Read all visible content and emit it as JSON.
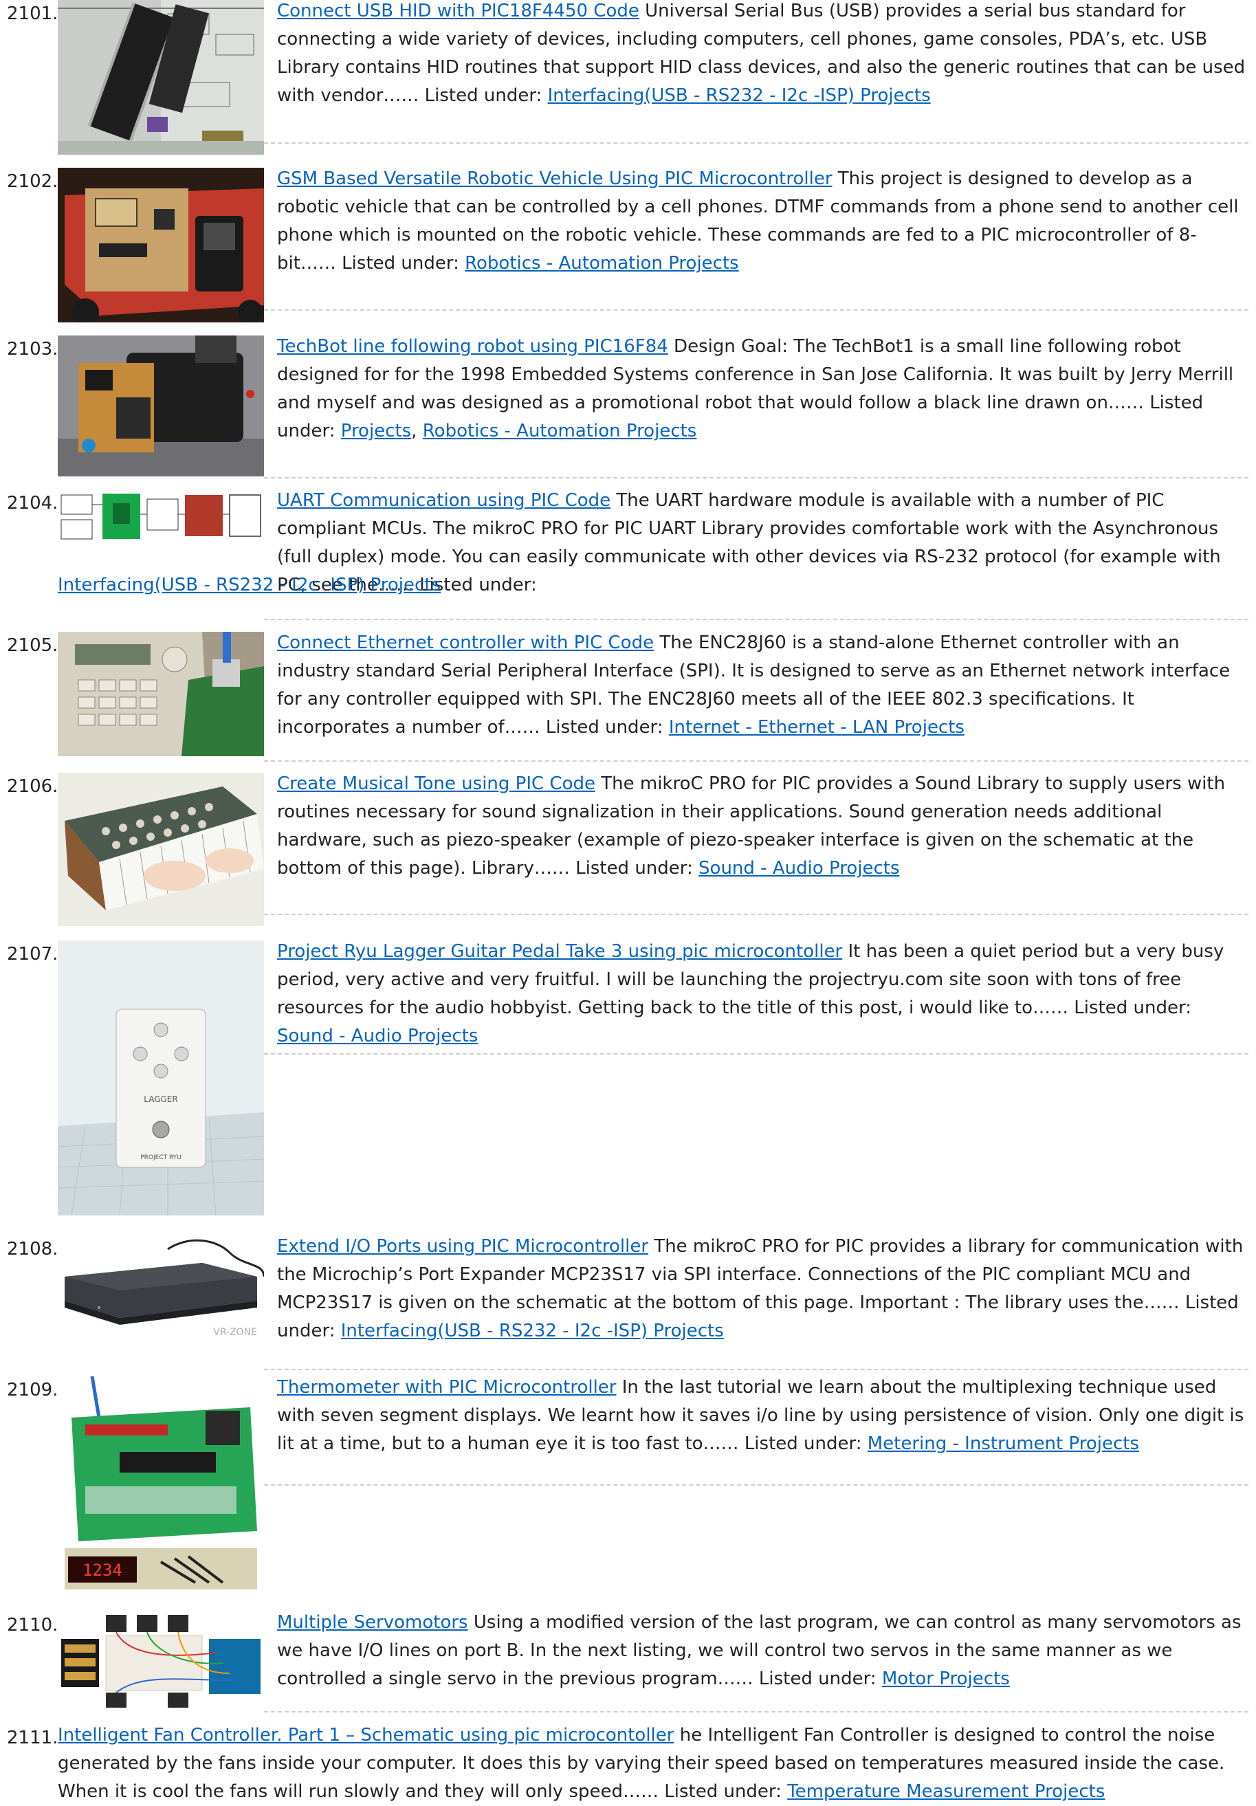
{
  "items": [
    {
      "num": "2101.",
      "title": "Connect USB HID with PIC18F4450 Code",
      "desc": " Universal Serial Bus (USB) provides a serial bus standard for connecting a wide variety of devices, including computers, cell phones, game consoles, PDA’s, etc. USB Library contains HID routines that support HID class devices, and also the generic routines that can be used with vendor…… Listed under: ",
      "cats": [
        "Interfacing(USB - RS232 - I2c -ISP) Projects"
      ],
      "image": "usb-hid-chips-photo"
    },
    {
      "num": "2102.",
      "title": "GSM Based Versatile Robotic Vehicle Using PIC Microcontroller",
      "desc": " This project is designed to develop as a robotic vehicle that can be controlled by a cell phones. DTMF commands from a phone send to another cell phone which is mounted on the robotic vehicle. These commands are fed to a PIC microcontroller of 8-bit…… Listed under: ",
      "cats": [
        "Robotics - Automation Projects"
      ],
      "image": "gsm-robot-vehicle-photo"
    },
    {
      "num": "2103.",
      "title": "TechBot line following robot using PIC16F84",
      "desc": " Design Goal: The TechBot1 is a small line following robot designed for for the 1998 Embedded Systems conference in San Jose California. It was built by Jerry Merrill and myself and was designed as a promotional robot that would follow a black line drawn on…… Listed under: ",
      "cats": [
        "Projects",
        "Robotics - Automation Projects"
      ],
      "image": "techbot-robot-photo"
    },
    {
      "num": "2104.",
      "title": "UART Communication using PIC Code",
      "desc": " The UART hardware module is available with a number of PIC compliant MCUs. The mikroC PRO for PIC UART Library provides comfortable work with the Asynchronous (full duplex) mode. You can easily communicate with other devices via RS-232 protocol (for example with PC, see the…… Listed under: ",
      "cats": [
        "Interfacing(USB - RS232 - I2c -ISP) Projects"
      ],
      "image": "uart-block-diagram"
    },
    {
      "num": "2105.",
      "title": "Connect Ethernet controller with PIC Code",
      "desc": " The ENC28J60 is a stand-alone Ethernet controller with an industry standard Serial Peripheral Interface (SPI). It is designed to serve as an Ethernet network interface for any controller equipped with SPI. The ENC28J60 meets all of the IEEE 802.3 specifications. It incorporates a number of…… Listed under: ",
      "cats": [
        "Internet - Ethernet - LAN Projects"
      ],
      "image": "ethernet-board-photo"
    },
    {
      "num": "2106.",
      "title": "Create Musical Tone using PIC Code",
      "desc": " The mikroC PRO for PIC provides a Sound Library to supply users with routines necessary for sound signalization in their applications. Sound generation needs additional hardware, such as piezo-speaker (example of piezo-speaker interface is given on the schematic at the bottom of this page). Library…… Listed under: ",
      "cats": [
        "Sound - Audio Projects"
      ],
      "image": "synthesizer-illustration"
    },
    {
      "num": "2107.",
      "title": "Project Ryu Lagger Guitar Pedal Take 3 using pic microcontoller",
      "desc": " It has been a quiet period but a very busy period, very active and very fruitful. I will be launching the projectryu.com site soon with tons of free resources for the audio hobbyist. Getting back to the title of this post, i would like to…… Listed under: ",
      "cats": [
        "Sound - Audio Projects"
      ],
      "image": "guitar-pedal-photo",
      "pedal_label": "LAGGER",
      "pedal_brand": "PROJECT RYU"
    },
    {
      "num": "2108.",
      "title": "Extend I/O Ports using PIC Microcontroller",
      "desc": " The mikroC PRO for PIC provides a library for communication with the Microchip’s Port Expander MCP23S17 via SPI interface. Connections of the PIC compliant MCU and MCP23S17 is given on the schematic at the bottom of this page.   Important : The library uses the…… Listed under: ",
      "cats": [
        "Interfacing(USB - RS232 - I2c -ISP) Projects"
      ],
      "image": "external-drive-photo",
      "watermark": "VR-ZONE"
    },
    {
      "num": "2109.",
      "title": "Thermometer with PIC Microcontroller",
      "desc": " In the last tutorial we learn about the multiplexing technique used with seven segment displays. We learnt how it saves i/o line by using persistence of vision. Only one digit is lit at a time, but to a human eye it is too fast to…… Listed under: ",
      "cats": [
        "Metering - Instrument Projects"
      ],
      "image": "pic-dev-board-photo",
      "display_digits": "1234"
    },
    {
      "num": "2110.",
      "title": "Multiple Servomotors",
      "desc": " Using a modified version of the last program, we can control as many servomotors as we have I/O lines on port B. In the next listing, we will control two servos in the same manner as we controlled a single servo in the previous program…… Listed under: ",
      "cats": [
        "Motor Projects"
      ],
      "image": "servo-breadboard-photo"
    },
    {
      "num": "2111.",
      "title": "Intelligent Fan Controller. Part 1 – Schematic using pic microcontoller",
      "desc": " he Intelligent Fan Controller is designed to control the noise generated by the fans inside your computer. It does this by varying their speed based on temperatures measured inside the case. When it is cool the fans will run slowly and they will only speed…… Listed under: ",
      "cats": [
        "Temperature Measurement Projects"
      ]
    }
  ]
}
